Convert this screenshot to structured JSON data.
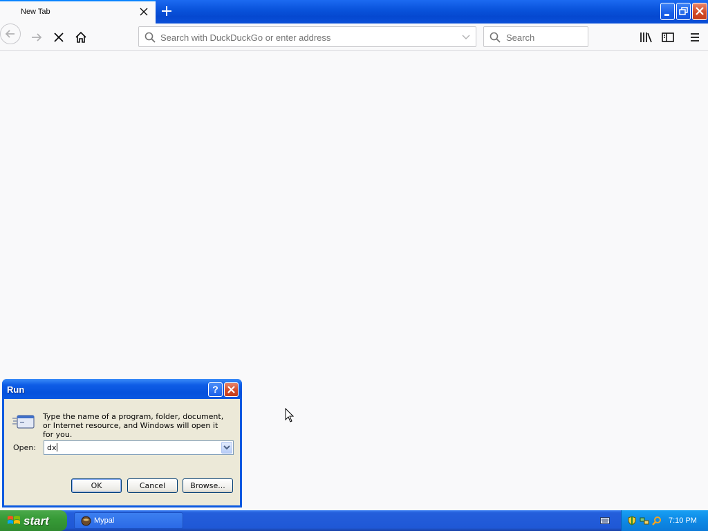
{
  "browser": {
    "tab": {
      "title": "New Tab"
    },
    "urlbar": {
      "placeholder": "Search with DuckDuckGo or enter address"
    },
    "searchbar": {
      "placeholder": "Search"
    }
  },
  "run_dialog": {
    "title": "Run",
    "help_label": "?",
    "description": "Type the name of a program, folder, document, or Internet resource, and Windows will open it for you.",
    "open_label": "Open:",
    "open_value": "dx",
    "buttons": {
      "ok": "OK",
      "cancel": "Cancel",
      "browse": "Browse..."
    }
  },
  "taskbar": {
    "start_label": "start",
    "tasks": [
      {
        "label": "Mypal",
        "icon": "mypal-icon"
      }
    ],
    "clock": "7:10 PM",
    "tray_icons": [
      "security-shield-icon",
      "network-icon",
      "search-icon"
    ]
  },
  "colors": {
    "xp_blue": "#0a54dc",
    "start_green": "#379b37",
    "firefox_accent": "#0a84ff",
    "dialog_face": "#ece9d8"
  }
}
